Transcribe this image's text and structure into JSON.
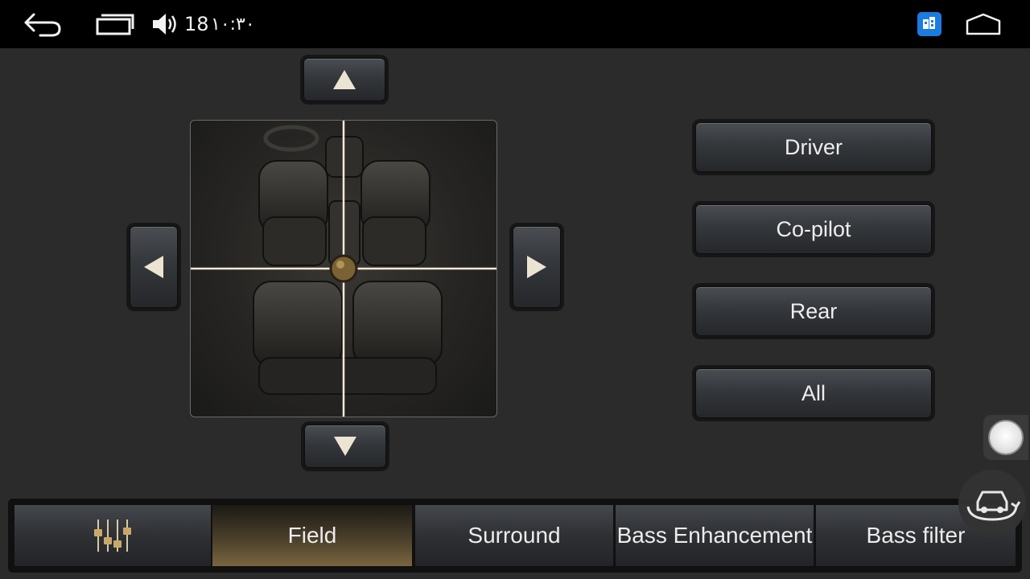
{
  "status_bar": {
    "volume_level": "18",
    "time": "۱۰:۳۰",
    "icons": [
      "back-arrow-icon",
      "recent-apps-icon",
      "volume-icon",
      "app-notification-icon",
      "home-icon"
    ]
  },
  "zones": {
    "items": [
      {
        "label": "Driver"
      },
      {
        "label": "Co-pilot"
      },
      {
        "label": "Rear"
      },
      {
        "label": "All"
      }
    ]
  },
  "tabs": {
    "items": [
      {
        "label": "",
        "icon": "equalizer-icon"
      },
      {
        "label": "Field",
        "active": true
      },
      {
        "label": "Surround"
      },
      {
        "label": "Bass Enhancement"
      },
      {
        "label": "Bass filter"
      }
    ]
  },
  "colors": {
    "accent_gold": "#b09060",
    "crosshair": "#f2ead6",
    "background": "#2b2b2b"
  }
}
